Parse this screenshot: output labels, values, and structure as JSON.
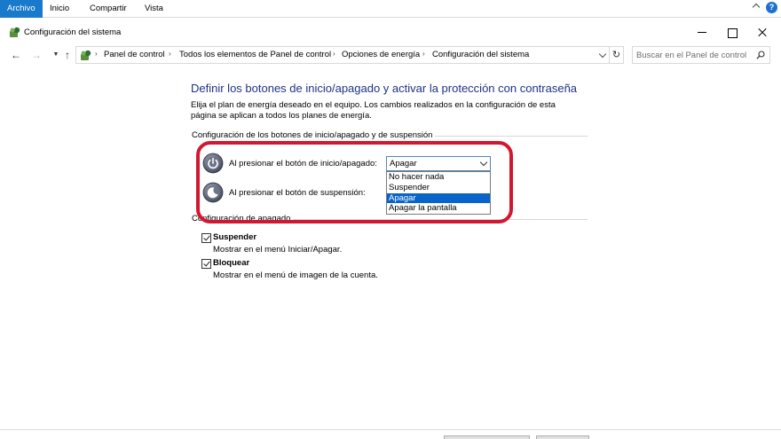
{
  "ribbon": {
    "tabs": [
      "Archivo",
      "Inicio",
      "Compartir",
      "Vista"
    ],
    "help_label": "?"
  },
  "window": {
    "title": "Configuración del sistema"
  },
  "address": {
    "breadcrumbs": [
      "Panel de control",
      "Todos los elementos de Panel de control",
      "Opciones de energía",
      "Configuración del sistema"
    ],
    "search_placeholder": "Buscar en el Panel de control"
  },
  "content": {
    "heading": "Definir los botones de inicio/apagado y activar la protección con contraseña",
    "description": "Elija el plan de energía deseado en el equipo. Los cambios realizados en la configuración de esta página se aplican a todos los planes de energía.",
    "section_buttons": "Configuración de los botones de inicio/apagado y de suspensión",
    "power_button_label": "Al presionar el botón de inicio/apagado:",
    "sleep_button_label": "Al presionar el botón de suspensión:",
    "power_button_value": "Apagar",
    "dropdown_options": [
      "No hacer nada",
      "Suspender",
      "Apagar",
      "Apagar la pantalla"
    ],
    "dropdown_selected": "Apagar",
    "section_shutdown": "Configuración de apagado",
    "checkboxes": [
      {
        "label": "Suspender",
        "description": "Mostrar en el menú Iniciar/Apagar.",
        "checked": true
      },
      {
        "label": "Bloquear",
        "description": "Mostrar en el menú de imagen de la cuenta.",
        "checked": true
      }
    ]
  },
  "colors": {
    "accent": "#1979ca",
    "heading": "#1e3287",
    "highlight_ring": "#d21830",
    "selection": "#0a63c9"
  }
}
